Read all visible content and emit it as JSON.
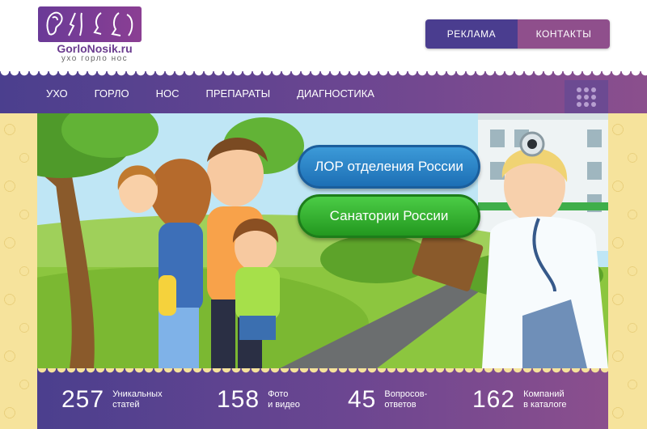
{
  "logo": {
    "name": "GorloNosik.ru",
    "tagline": "ухо горло нос"
  },
  "top_buttons": {
    "ads": "РЕКЛАМА",
    "contacts": "КОНТАКТЫ"
  },
  "nav": {
    "items": [
      "УХО",
      "ГОРЛО",
      "НОС",
      "ПРЕПАРАТЫ",
      "ДИАГНОСТИКА"
    ]
  },
  "banner": {
    "lor_button": "ЛОР отделения России",
    "sanatorium_button": "Санатории России"
  },
  "stats": [
    {
      "number": "257",
      "line1": "Уникальных",
      "line2": "статей"
    },
    {
      "number": "158",
      "line1": "Фото",
      "line2": "и видео"
    },
    {
      "number": "45",
      "line1": "Вопросов-",
      "line2": "ответов"
    },
    {
      "number": "162",
      "line1": "Компаний",
      "line2": "в каталоге"
    }
  ],
  "colors": {
    "purple_dark": "#4b3f8e",
    "purple_light": "#8b4f8d",
    "yellow_bg": "#f6e39c",
    "blue_button": "#2a84c8",
    "green_button": "#33b12e"
  }
}
